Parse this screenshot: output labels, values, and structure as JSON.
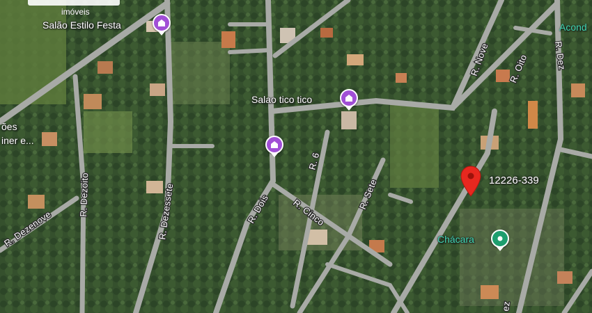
{
  "watermark": {
    "text": "imóveis"
  },
  "pois": [
    {
      "label": "Salão Estilo Festa",
      "icon": "party-venue-icon"
    },
    {
      "label": "Salao tico tico",
      "icon": "party-venue-icon"
    },
    {
      "label": "",
      "icon": "party-venue-icon"
    },
    {
      "label": "Chácara",
      "icon": "location-dot-icon"
    }
  ],
  "marker": {
    "label": "12226-339",
    "icon": "red-location-pin-icon"
  },
  "streets": {
    "nove": "R. Nove",
    "oito": "R. Oito",
    "dez": "R. Dez",
    "seis": "R. 6",
    "sete": "R. Sete",
    "cinco": "R. Cinco",
    "dois": "R. Dois",
    "dezessete": "R. Dezessete",
    "dezoito": "R. Dezoito",
    "dezenove": "R. Dezenove",
    "dez_bottom": "ez"
  },
  "edge_labels": {
    "top_right": "Acond",
    "left_1": "ões",
    "left_2": "iner e..."
  },
  "colors": {
    "poi_purple": "#a14fd6",
    "poi_green": "#1e9e6e",
    "marker_red": "#e8281f",
    "road": "#a8aaa6"
  }
}
